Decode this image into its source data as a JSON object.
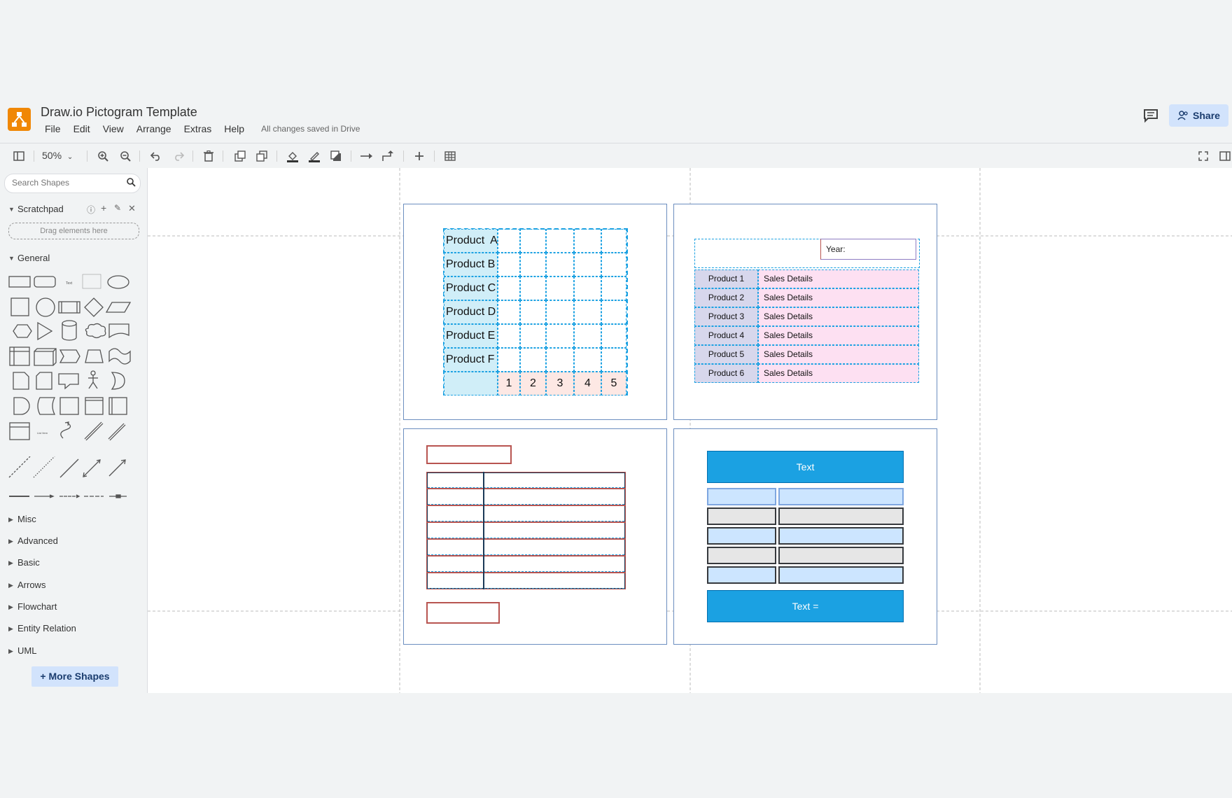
{
  "app": {
    "title": "Draw.io Pictogram Template",
    "menus": [
      "File",
      "Edit",
      "View",
      "Arrange",
      "Extras",
      "Help"
    ],
    "save_status": "All changes saved in Drive",
    "share_label": "Share",
    "accent": "#f08705"
  },
  "toolbar": {
    "zoom": "50%",
    "icons": [
      "format-panel-icon",
      "zoom-in-icon",
      "zoom-out-icon",
      "undo-icon",
      "redo-icon",
      "delete-icon",
      "to-front-icon",
      "to-back-icon",
      "fill-color-icon",
      "line-color-icon",
      "shadow-icon",
      "connection-icon",
      "waypoints-icon",
      "insert-icon",
      "table-icon",
      "fullscreen-icon",
      "toggle-panel-icon"
    ]
  },
  "sidebar": {
    "search_placeholder": "Search Shapes",
    "scratchpad_label": "Scratchpad",
    "dropzone_label": "Drag elements here",
    "general_label": "General",
    "sections": [
      "Misc",
      "Advanced",
      "Basic",
      "Arrows",
      "Flowchart",
      "Entity Relation",
      "UML"
    ],
    "more_shapes_label": "+ More Shapes"
  },
  "diagram": {
    "pictogram": {
      "rows": [
        "Product  A",
        "Product B",
        "Product C",
        "Product D",
        "Product E",
        "Product F"
      ],
      "columns": [
        "1",
        "2",
        "3",
        "4",
        "5"
      ]
    },
    "sales_table": {
      "year_label": "Year:",
      "rows": [
        {
          "product": "Product 1",
          "details": "Sales Details"
        },
        {
          "product": "Product 2",
          "details": "Sales Details"
        },
        {
          "product": "Product 3",
          "details": "Sales Details"
        },
        {
          "product": "Product 4",
          "details": "Sales Details"
        },
        {
          "product": "Product 5",
          "details": "Sales Details"
        },
        {
          "product": "Product 6",
          "details": "Sales Details"
        }
      ]
    },
    "blue_table": {
      "header": "Text",
      "footer": "Text ="
    }
  }
}
